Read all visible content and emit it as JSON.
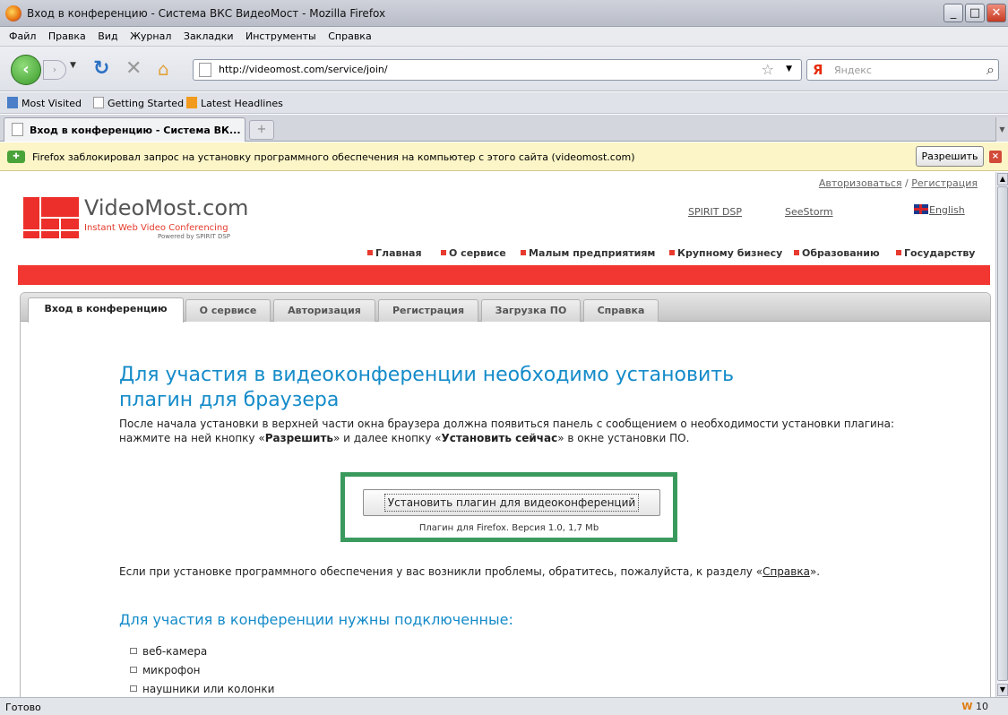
{
  "window": {
    "title": "Вход в конференцию - Система ВКС ВидеоМост - Mozilla Firefox"
  },
  "menu": [
    "Файл",
    "Правка",
    "Вид",
    "Журнал",
    "Закладки",
    "Инструменты",
    "Справка"
  ],
  "nav": {
    "url": "http://videomost.com/service/join/",
    "search_placeholder": "Яндекс",
    "search_engine": "Я"
  },
  "bookmarks": [
    "Most Visited",
    "Getting Started",
    "Latest Headlines"
  ],
  "tab": {
    "title": "Вход в конференцию - Система ВК..."
  },
  "notification": {
    "text": "Firefox заблокировал запрос на установку программного обеспечения на компьютер с этого сайта (videomost.com)",
    "allow_label": "Разрешить"
  },
  "site": {
    "login_link": "Авторизоваться",
    "sep": "/",
    "register_link": "Регистрация",
    "logo_text": "VideoMost.com",
    "logo_subtitle": "Instant Web Video Conferencing",
    "logo_powered": "Powered by SPIRIT DSP",
    "ext_links": [
      "SPIRIT DSP",
      "SeeStorm",
      "English"
    ],
    "main_nav": [
      "Главная",
      "О сервисе",
      "Малым предприятиям",
      "Крупному бизнесу",
      "Образованию",
      "Государству"
    ]
  },
  "panel": {
    "tabs": [
      "Вход в конференцию",
      "О сервисе",
      "Авторизация",
      "Регистрация",
      "Загрузка ПО",
      "Справка"
    ],
    "heading": "Для участия в видеоконференции необходимо установить плагин для браузера",
    "para_1": "После начала установки в верхней части окна браузера должна появиться панель с сообщением о необходимости установки плагина: нажмите на ней кнопку «",
    "para_b1": "Разрешить",
    "para_2": "» и далее кнопку «",
    "para_b2": "Установить сейчас",
    "para_3": "» в окне установки ПО.",
    "install_button": "Установить плагин для видеоконференций",
    "install_note": "Плагин для Firefox. Версия 1.0, 1,7 Mb",
    "help_1": "Если при установке программного обеспечения у вас возникли проблемы, обратитесь, пожалуйста, к разделу «",
    "help_link": "Справка",
    "help_2": "».",
    "subheading": "Для участия в конференции нужны подключенные:",
    "requirements": [
      "веб-камера",
      "микрофон",
      "наушники или колонки"
    ]
  },
  "status": {
    "text": "Готово",
    "counter": "10"
  },
  "colors": {
    "accent_red": "#f23732",
    "link_blue": "#148bc9",
    "highlight_green": "#3a9a5d"
  }
}
